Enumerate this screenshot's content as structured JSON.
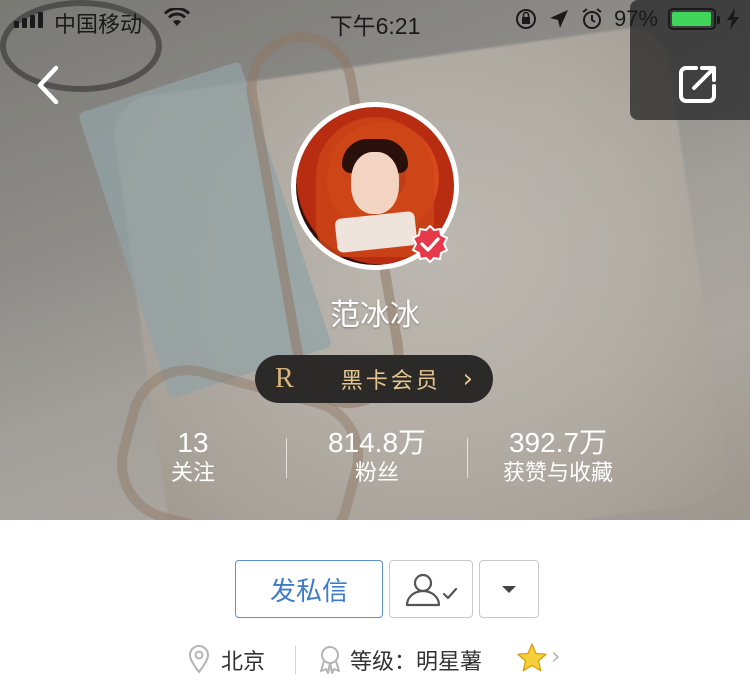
{
  "status_bar": {
    "carrier": "中国移动",
    "time": "下午6:21",
    "battery": "97%",
    "battery_level": 0.97,
    "battery_color": "#41d55b"
  },
  "header": {
    "back_icon": "back-chevron-icon",
    "share_icon": "share-icon"
  },
  "profile": {
    "name": "范冰冰",
    "verified_badge_color": "#e8394b",
    "vip": {
      "badge_letter": "R",
      "label": "黑卡会员",
      "arrow": "›"
    },
    "stats": [
      {
        "value": "13",
        "label": "关注"
      },
      {
        "value": "814.8万",
        "label": "粉丝"
      },
      {
        "value": "392.7万",
        "label": "获赞与收藏"
      }
    ]
  },
  "actions": {
    "message_label": "发私信",
    "accent_color": "#3e7cc8"
  },
  "info": {
    "location": "北京",
    "level": "等级：明星薯",
    "chevron": "›"
  }
}
